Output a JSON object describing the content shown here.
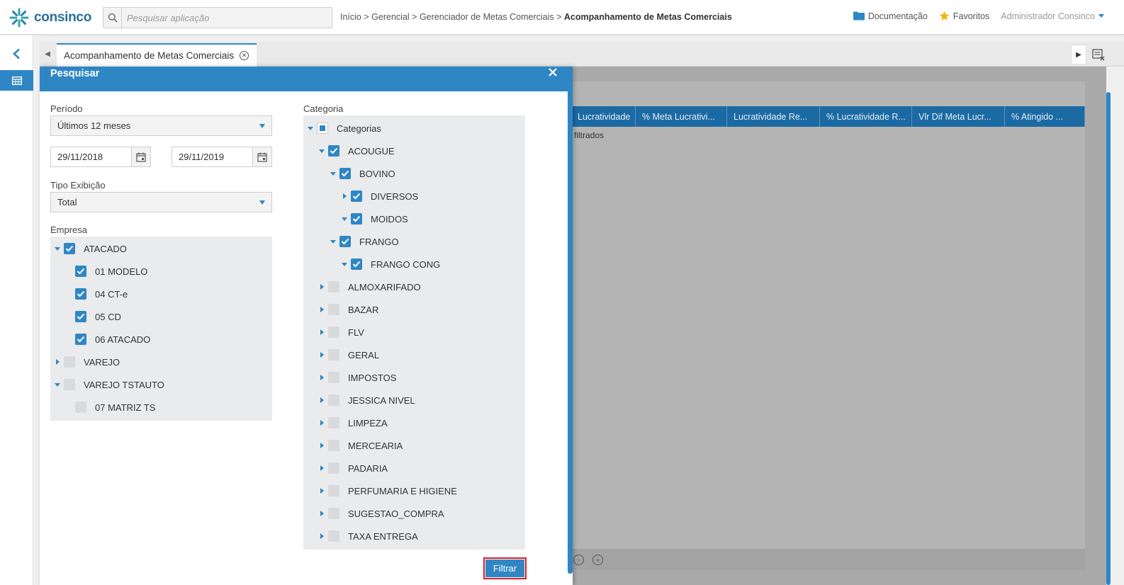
{
  "app": {
    "logo_text": "consinco"
  },
  "search": {
    "placeholder": "Pesquisar aplicação"
  },
  "breadcrumb": {
    "items": [
      "Início",
      "Gerencial",
      "Gerenciador de Metas Comerciais"
    ],
    "current": "Acompanhamento de Metas Comerciais",
    "separator": ">"
  },
  "topright": {
    "docs": "Documentação",
    "favorites": "Favoritos",
    "user": "Administrador Consinco"
  },
  "tab": {
    "label": "Acompanhamento de Metas Comerciais"
  },
  "grid": {
    "columns": [
      "Lucratividade",
      "% Meta Lucrativi...",
      "Lucratividade Re...",
      "% Lucratividade R...",
      "Vlr Dif Meta Lucr...",
      "% Atingido ..."
    ],
    "message": "filtrados"
  },
  "dialog": {
    "title": "Pesquisar",
    "periodo_label": "Período",
    "periodo_value": "Últimos 12 meses",
    "date_from": "29/11/2018",
    "date_to": "29/11/2019",
    "tipo_label": "Tipo Exibição",
    "tipo_value": "Total",
    "empresa_label": "Empresa",
    "categoria_label": "Categoria",
    "filter_button": "Filtrar"
  },
  "empresa_tree": [
    {
      "label": "ATACADO",
      "level": 0,
      "toggle": "down",
      "state": "checked"
    },
    {
      "label": "01 MODELO",
      "level": 1,
      "toggle": "none",
      "state": "checked"
    },
    {
      "label": "04 CT-e",
      "level": 1,
      "toggle": "none",
      "state": "checked"
    },
    {
      "label": "05 CD",
      "level": 1,
      "toggle": "none",
      "state": "checked"
    },
    {
      "label": "06 ATACADO",
      "level": 1,
      "toggle": "none",
      "state": "checked"
    },
    {
      "label": "VAREJO",
      "level": 0,
      "toggle": "right",
      "state": "unchecked"
    },
    {
      "label": "VAREJO TSTAUTO",
      "level": 0,
      "toggle": "down",
      "state": "unchecked"
    },
    {
      "label": "07 MATRIZ TS",
      "level": 1,
      "toggle": "none",
      "state": "unchecked"
    }
  ],
  "categoria_tree": [
    {
      "label": "Categorias",
      "level": 0,
      "toggle": "down",
      "state": "partial"
    },
    {
      "label": "ACOUGUE",
      "level": 1,
      "toggle": "down",
      "state": "checked"
    },
    {
      "label": "BOVINO",
      "level": 2,
      "toggle": "down",
      "state": "checked"
    },
    {
      "label": "DIVERSOS",
      "level": 3,
      "toggle": "right",
      "state": "checked"
    },
    {
      "label": "MOIDOS",
      "level": 3,
      "toggle": "down",
      "state": "checked"
    },
    {
      "label": "FRANGO",
      "level": 2,
      "toggle": "down",
      "state": "checked"
    },
    {
      "label": "FRANGO CONG",
      "level": 3,
      "toggle": "down",
      "state": "checked"
    },
    {
      "label": "ALMOXARIFADO",
      "level": 1,
      "toggle": "right",
      "state": "unchecked"
    },
    {
      "label": "BAZAR",
      "level": 1,
      "toggle": "right",
      "state": "unchecked"
    },
    {
      "label": "FLV",
      "level": 1,
      "toggle": "right",
      "state": "unchecked"
    },
    {
      "label": "GERAL",
      "level": 1,
      "toggle": "right",
      "state": "unchecked"
    },
    {
      "label": "IMPOSTOS",
      "level": 1,
      "toggle": "right",
      "state": "unchecked"
    },
    {
      "label": "JESSICA NIVEL",
      "level": 1,
      "toggle": "right",
      "state": "unchecked"
    },
    {
      "label": "LIMPEZA",
      "level": 1,
      "toggle": "right",
      "state": "unchecked"
    },
    {
      "label": "MERCEARIA",
      "level": 1,
      "toggle": "right",
      "state": "unchecked"
    },
    {
      "label": "PADARIA",
      "level": 1,
      "toggle": "right",
      "state": "unchecked"
    },
    {
      "label": "PERFUMARIA E HIGIENE",
      "level": 1,
      "toggle": "right",
      "state": "unchecked"
    },
    {
      "label": "SUGESTAO_COMPRA",
      "level": 1,
      "toggle": "right",
      "state": "unchecked"
    },
    {
      "label": "TAXA ENTREGA",
      "level": 1,
      "toggle": "right",
      "state": "unchecked"
    }
  ],
  "colors": {
    "accent": "#2f86c5",
    "grid_header": "#1c6aa3",
    "highlight": "#e01b22",
    "favorite_star": "#f0b400"
  },
  "icons": {
    "search": "search-icon",
    "folder": "folder-icon",
    "star": "star-icon",
    "calendar": "calendar-icon",
    "close": "close-icon"
  }
}
